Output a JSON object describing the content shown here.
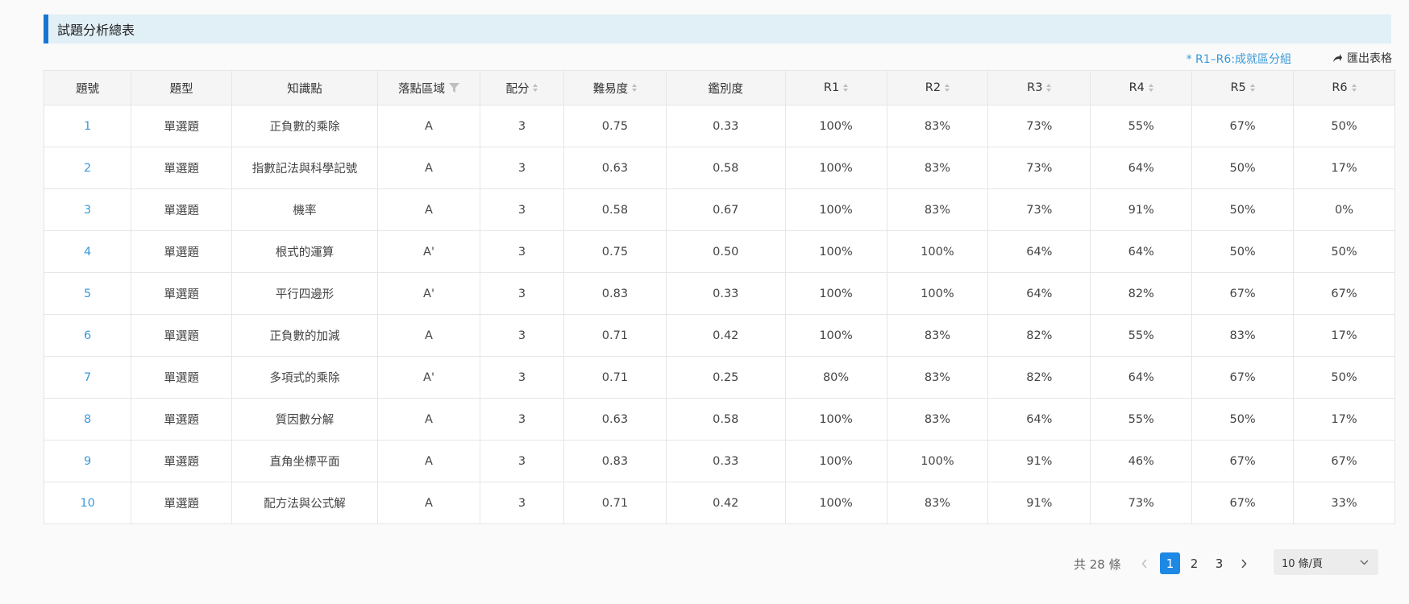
{
  "section": {
    "title": "試題分析總表"
  },
  "note": "* R1–R6:成就區分組",
  "export_label": "匯出表格",
  "table": {
    "headers": {
      "no": "題號",
      "type": "題型",
      "topic": "知識點",
      "zone": "落點區域",
      "score": "配分",
      "difficulty": "難易度",
      "discrimination": "鑑別度",
      "r1": "R1",
      "r2": "R2",
      "r3": "R3",
      "r4": "R4",
      "r5": "R5",
      "r6": "R6"
    },
    "rows": [
      {
        "no": "1",
        "type": "單選題",
        "topic": "正負數的乘除",
        "zone": "A",
        "score": "3",
        "difficulty": "0.75",
        "discrimination": "0.33",
        "r1": "100%",
        "r2": "83%",
        "r3": "73%",
        "r4": "55%",
        "r5": "67%",
        "r6": "50%"
      },
      {
        "no": "2",
        "type": "單選題",
        "topic": "指數記法與科學記號",
        "zone": "A",
        "score": "3",
        "difficulty": "0.63",
        "discrimination": "0.58",
        "r1": "100%",
        "r2": "83%",
        "r3": "73%",
        "r4": "64%",
        "r5": "50%",
        "r6": "17%"
      },
      {
        "no": "3",
        "type": "單選題",
        "topic": "機率",
        "zone": "A",
        "score": "3",
        "difficulty": "0.58",
        "discrimination": "0.67",
        "r1": "100%",
        "r2": "83%",
        "r3": "73%",
        "r4": "91%",
        "r5": "50%",
        "r6": "0%"
      },
      {
        "no": "4",
        "type": "單選題",
        "topic": "根式的運算",
        "zone": "A'",
        "score": "3",
        "difficulty": "0.75",
        "discrimination": "0.50",
        "r1": "100%",
        "r2": "100%",
        "r3": "64%",
        "r4": "64%",
        "r5": "50%",
        "r6": "50%"
      },
      {
        "no": "5",
        "type": "單選題",
        "topic": "平行四邊形",
        "zone": "A'",
        "score": "3",
        "difficulty": "0.83",
        "discrimination": "0.33",
        "r1": "100%",
        "r2": "100%",
        "r3": "64%",
        "r4": "82%",
        "r5": "67%",
        "r6": "67%"
      },
      {
        "no": "6",
        "type": "單選題",
        "topic": "正負數的加減",
        "zone": "A",
        "score": "3",
        "difficulty": "0.71",
        "discrimination": "0.42",
        "r1": "100%",
        "r2": "83%",
        "r3": "82%",
        "r4": "55%",
        "r5": "83%",
        "r6": "17%"
      },
      {
        "no": "7",
        "type": "單選題",
        "topic": "多項式的乘除",
        "zone": "A'",
        "score": "3",
        "difficulty": "0.71",
        "discrimination": "0.25",
        "r1": "80%",
        "r2": "83%",
        "r3": "82%",
        "r4": "64%",
        "r5": "67%",
        "r6": "50%"
      },
      {
        "no": "8",
        "type": "單選題",
        "topic": "質因數分解",
        "zone": "A",
        "score": "3",
        "difficulty": "0.63",
        "discrimination": "0.58",
        "r1": "100%",
        "r2": "83%",
        "r3": "64%",
        "r4": "55%",
        "r5": "50%",
        "r6": "17%"
      },
      {
        "no": "9",
        "type": "單選題",
        "topic": "直角坐標平面",
        "zone": "A",
        "score": "3",
        "difficulty": "0.83",
        "discrimination": "0.33",
        "r1": "100%",
        "r2": "100%",
        "r3": "91%",
        "r4": "46%",
        "r5": "67%",
        "r6": "67%"
      },
      {
        "no": "10",
        "type": "單選題",
        "topic": "配方法與公式解",
        "zone": "A",
        "score": "3",
        "difficulty": "0.71",
        "discrimination": "0.42",
        "r1": "100%",
        "r2": "83%",
        "r3": "91%",
        "r4": "73%",
        "r5": "67%",
        "r6": "33%"
      }
    ]
  },
  "pagination": {
    "total_label": "共 28 條",
    "current_page": "1",
    "pages": [
      "1",
      "2",
      "3"
    ],
    "prev_icon": "chevron-left-icon",
    "next_icon": "chevron-right-icon",
    "page_size": "10 條/頁"
  },
  "colors": {
    "accent": "#1677d2",
    "link": "#3a9ad9",
    "header_band": "#e1eff6",
    "active_page": "#1e88e5"
  }
}
